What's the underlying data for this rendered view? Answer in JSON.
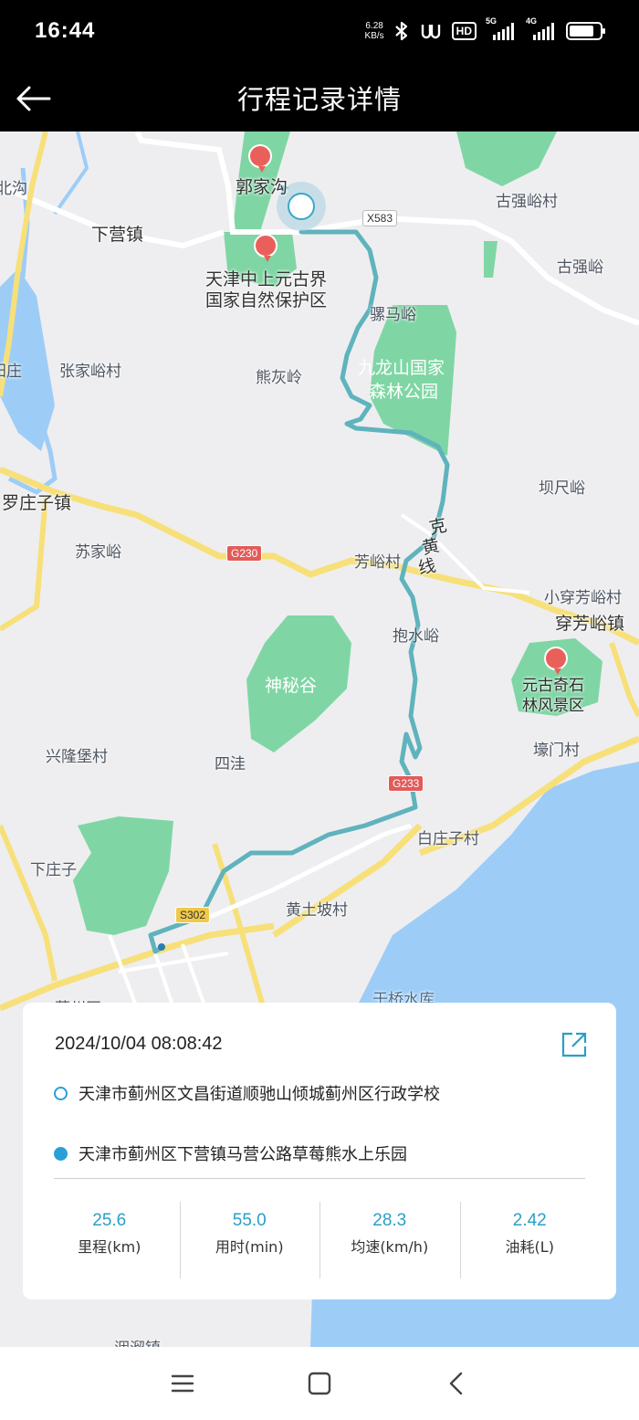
{
  "status_bar": {
    "time": "16:44",
    "net_speed_value": "6.28",
    "net_speed_unit": "KB/s",
    "hd_label": "HD",
    "sim1_label": "5G",
    "sim2_label": "4G",
    "icons": [
      "bluetooth-icon",
      "vibrate-icon",
      "hd-voice-icon",
      "signal-5g-icon",
      "signal-4g-icon",
      "battery-icon"
    ]
  },
  "header": {
    "title": "行程记录详情",
    "back_icon": "back-arrow-icon"
  },
  "map": {
    "place_labels": [
      "郭家沟",
      "下营镇",
      "天津中上元古界",
      "国家自然保护区",
      "北沟",
      "古强峪村",
      "古强峪",
      "骡马峪",
      "九龙山国家",
      "森林公园",
      "熊灰岭",
      "张家峪村",
      "阳庄",
      "罗庄子镇",
      "坝尺峪",
      "克",
      "黄",
      "线",
      "苏家峪",
      "芳峪村",
      "小穿芳峪村",
      "穿芳峪镇",
      "抱水峪",
      "神秘谷",
      "元古奇石",
      "林风景区",
      "兴隆堡村",
      "四洼",
      "壕门村",
      "白庄子村",
      "下庄子",
      "黄土坡村",
      "于桥水库",
      "蓟州区",
      "洇溜镇"
    ],
    "road_labels": [
      "X583",
      "G230",
      "G233",
      "S302"
    ],
    "accent_route": "#5fb3bd",
    "accent_park": "#7fd6a4",
    "accent_water": "#9dcdf7",
    "accent_road": "#f7e07a"
  },
  "trip": {
    "datetime": "2024/10/04 08:08:42",
    "start_address": "天津市蓟州区文昌街道顺驰山倾城蓟州区行政学校",
    "end_address": "天津市蓟州区下营镇马营公路草莓熊水上乐园",
    "share_icon": "share-external-icon",
    "stats": [
      {
        "value": "25.6",
        "label": "里程(km)"
      },
      {
        "value": "55.0",
        "label": "用时(min)"
      },
      {
        "value": "28.3",
        "label": "均速(km/h)"
      },
      {
        "value": "2.42",
        "label": "油耗(L)"
      }
    ],
    "accent": "#2a9fc6"
  },
  "nav_bar": {
    "icons": [
      "menu-icon",
      "home-square-icon",
      "back-chevron-icon"
    ]
  }
}
